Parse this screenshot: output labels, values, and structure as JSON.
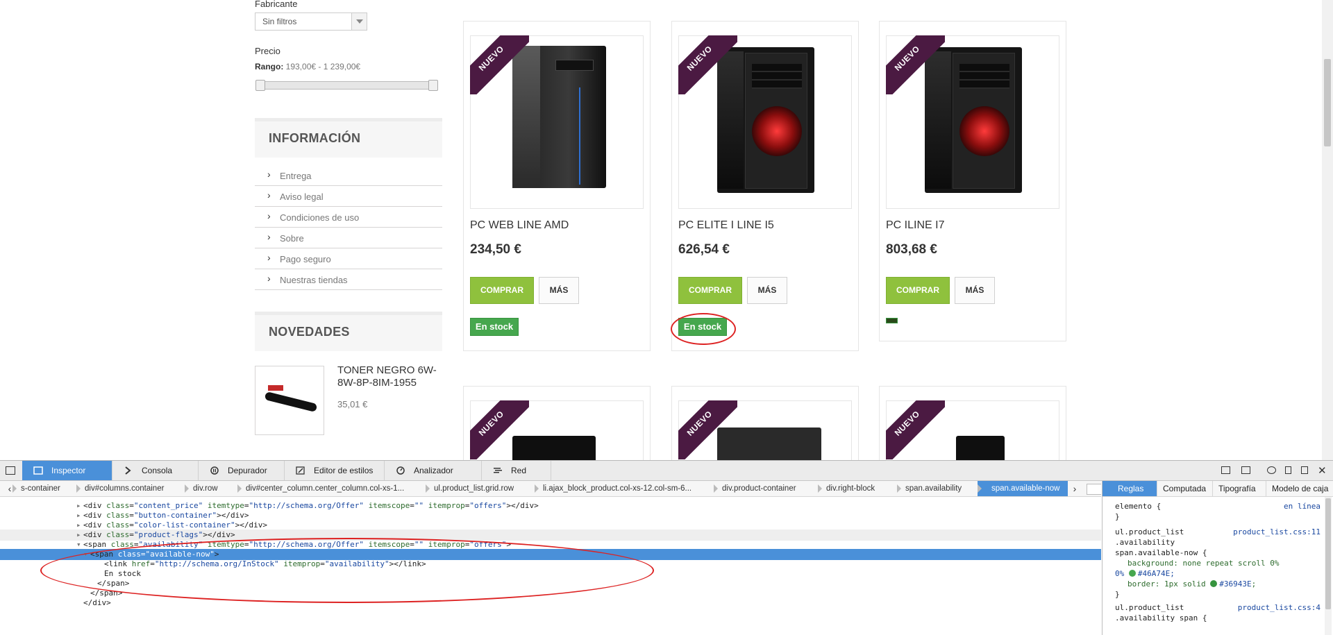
{
  "sidebar": {
    "manufacturer_label": "Fabricante",
    "manufacturer_value": "Sin filtros",
    "price_label": "Precio",
    "range_label": "Rango:",
    "range_value": "193,00€ - 1 239,00€",
    "info_title": "INFORMACIÓN",
    "info_items": [
      "Entrega",
      "Aviso legal",
      "Condiciones de uso",
      "Sobre",
      "Pago seguro",
      "Nuestras tiendas"
    ],
    "news_title": "NOVEDADES",
    "news_item": {
      "title": "TONER NEGRO 6W-8W-8P-8IM-1955",
      "price": "35,01 €"
    }
  },
  "products": [
    {
      "badge": "NUEVO",
      "name": "PC WEB LINE AMD",
      "price": "234,50 €",
      "buy": "COMPRAR",
      "more": "MÁS",
      "stock": "En stock"
    },
    {
      "badge": "NUEVO",
      "name": "PC ELITE I LINE I5",
      "price": "626,54 €",
      "buy": "COMPRAR",
      "more": "MÁS",
      "stock": "En stock"
    },
    {
      "badge": "NUEVO",
      "name": "PC ILINE I7",
      "price": "803,68 €",
      "buy": "COMPRAR",
      "more": "MÁS",
      "stock": ""
    }
  ],
  "products_row2_badges": [
    "NUEVO",
    "NUEVO",
    "NUEVO"
  ],
  "devtools": {
    "tabs": [
      "Inspector",
      "Consola",
      "Depurador",
      "Editor de estilos",
      "Analizador",
      "Red"
    ],
    "breadcrumbs": [
      "s-container",
      "div#columns.container",
      "div.row",
      "div#center_column.center_column.col-xs-1...",
      "ul.product_list.grid.row",
      "li.ajax_block_product.col-xs-12.col-sm-6...",
      "div.product-container",
      "div.right-block",
      "span.availability",
      "span.available-now"
    ],
    "code_lines": [
      {
        "indent": 11,
        "twisty": "▸",
        "tag": "<div",
        "attrs": [
          [
            "class",
            "content_price"
          ],
          [
            "itemtype",
            "http://schema.org/Offer"
          ],
          [
            "itemscope",
            ""
          ],
          [
            "itemprop",
            "offers"
          ]
        ],
        "close": "></div>"
      },
      {
        "indent": 11,
        "twisty": "▸",
        "tag": "<div",
        "attrs": [
          [
            "class",
            "button-container"
          ]
        ],
        "close": "></div>"
      },
      {
        "indent": 11,
        "twisty": "▸",
        "tag": "<div",
        "attrs": [
          [
            "class",
            "color-list-container"
          ]
        ],
        "close": "></div>"
      },
      {
        "indent": 11,
        "twisty": "▸",
        "tag": "<div",
        "attrs": [
          [
            "class",
            "product-flags"
          ]
        ],
        "close": "></div>"
      },
      {
        "indent": 11,
        "twisty": "▾",
        "tag": "<span",
        "attrs": [
          [
            "class",
            "availability"
          ],
          [
            "itemtype",
            "http://schema.org/Offer"
          ],
          [
            "itemscope",
            ""
          ],
          [
            "itemprop",
            "offers"
          ]
        ],
        "close": ">"
      },
      {
        "indent": 12,
        "twisty": "▾",
        "tag": "<span",
        "attrs": [
          [
            "class",
            "available-now"
          ]
        ],
        "close": ">",
        "highlight": true
      },
      {
        "indent": 14,
        "twisty": "",
        "tag": "<link",
        "attrs": [
          [
            "href",
            "http://schema.org/InStock"
          ],
          [
            "itemprop",
            "availability"
          ]
        ],
        "close": "></link>"
      },
      {
        "indent": 14,
        "twisty": "",
        "text": "En stock"
      },
      {
        "indent": 13,
        "twisty": "",
        "text": "</span>"
      },
      {
        "indent": 12,
        "twisty": "",
        "text": "</span>"
      },
      {
        "indent": 11,
        "twisty": "",
        "text": "</div>"
      }
    ],
    "rules_tabs": [
      "Reglas",
      "Computada",
      "Tipografía",
      "Modelo de caja"
    ],
    "rules": {
      "element": "elemento {",
      "element_src": "en línea",
      "close": "}",
      "sel1": [
        "ul.product_list",
        ".availability",
        "span.available-now {"
      ],
      "sel1_src": "product_list.css:11",
      "bg_prop": "background: none repeat scroll 0%",
      "bg_prop2": "0%",
      "bg_color": "#46A74E",
      "border_prop": "border: 1px solid",
      "border_color": "#36943E",
      "sel2": [
        "ul.product_list",
        ".availability span {"
      ],
      "sel2_src": "product_list.css:4"
    }
  },
  "colors": {
    "buy": "#8FC13D",
    "stock": "#46A74E",
    "stock_border": "#36943E",
    "ribbon": "#4B1A42",
    "devtools_accent": "#4A90D9"
  }
}
